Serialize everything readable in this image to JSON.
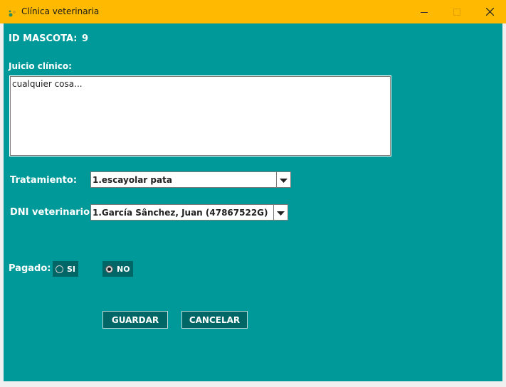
{
  "window": {
    "title": "Clínica veterinaria",
    "icon": "paw-app-icon",
    "accent": "#ffb900",
    "background": "#009999"
  },
  "pet": {
    "id_label": "ID MASCOTA:",
    "id_value": "9"
  },
  "clinical": {
    "label": "Juicio clínico:",
    "value": "cualquier cosa..."
  },
  "treatment": {
    "label": "Tratamiento:",
    "selected": "1.escayolar pata"
  },
  "vet": {
    "label": "DNI veterinario:",
    "selected": "1.García Sânchez, Juan (47867522G)"
  },
  "paid": {
    "label": "Pagado:",
    "options": [
      {
        "label": "SI",
        "selected": false
      },
      {
        "label": "NO",
        "selected": true
      }
    ]
  },
  "buttons": {
    "save": "GUARDAR",
    "cancel": "CANCELAR"
  }
}
